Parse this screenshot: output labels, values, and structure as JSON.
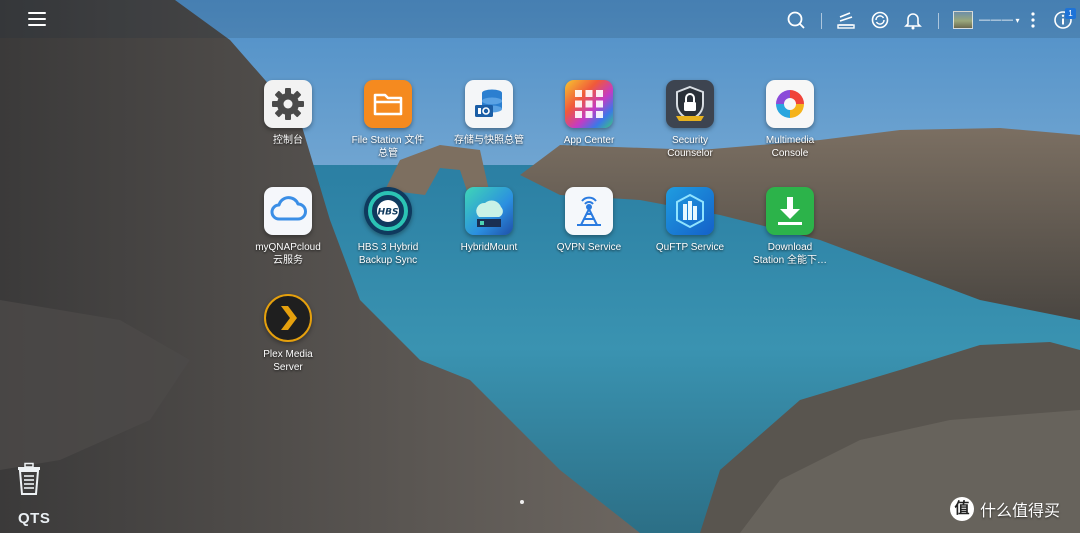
{
  "topbar": {
    "icons": [
      "menu-icon",
      "search-icon",
      "task-icon",
      "sync-icon",
      "bell-icon",
      "more-icon",
      "info-icon"
    ],
    "user": {
      "name": "———",
      "caret": "▾"
    },
    "notification_count": "1"
  },
  "apps": [
    {
      "id": "control-panel",
      "label": "控制台",
      "icon": "gear-icon"
    },
    {
      "id": "file-station",
      "label": "File Station 文件\n总管",
      "icon": "folder-icon"
    },
    {
      "id": "storage",
      "label": "存储与快照总管",
      "icon": "database-icon"
    },
    {
      "id": "app-center",
      "label": "App Center",
      "icon": "grid-icon"
    },
    {
      "id": "security-counselor",
      "label": "Security\nCounselor",
      "icon": "shield-lock-icon"
    },
    {
      "id": "multimedia-console",
      "label": "Multimedia\nConsole",
      "icon": "ring-icon"
    },
    {
      "id": "myqnapcloud",
      "label": "myQNAPcloud\n云服务",
      "icon": "cloud-icon"
    },
    {
      "id": "hbs3",
      "label": "HBS 3 Hybrid\nBackup Sync",
      "icon": "hbs-icon"
    },
    {
      "id": "hybridmount",
      "label": "HybridMount",
      "icon": "hybridmount-icon"
    },
    {
      "id": "qvpn",
      "label": "QVPN Service",
      "icon": "vpn-tower-icon"
    },
    {
      "id": "quftp",
      "label": "QuFTP Service",
      "icon": "ftp-icon"
    },
    {
      "id": "download-station",
      "label": "Download\nStation 全能下…",
      "icon": "download-icon"
    },
    {
      "id": "plex",
      "label": "Plex Media\nServer",
      "icon": "plex-chevron-icon"
    }
  ],
  "bottom": {
    "brand": "QTS",
    "watermark_logo": "值",
    "watermark_text": "什么值得买"
  }
}
